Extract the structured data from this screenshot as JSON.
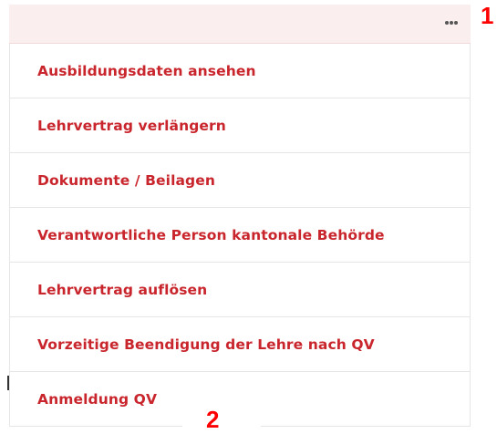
{
  "header": {
    "more_icon": "ellipsis-horizontal-icon",
    "background_color": "#fbeeee"
  },
  "menu": {
    "item_color": "#c9252c",
    "items": [
      {
        "label": "Ausbildungsdaten ansehen"
      },
      {
        "label": "Lehrvertrag verlängern"
      },
      {
        "label": "Dokumente / Beilagen"
      },
      {
        "label": "Verantwortliche Person kantonale Behörde"
      },
      {
        "label": "Lehrvertrag auflösen"
      },
      {
        "label": "Vorzeitige Beendigung der Lehre nach QV"
      },
      {
        "label": "Anmeldung QV"
      }
    ]
  },
  "callouts": {
    "first": "1",
    "second": "2",
    "color": "#ff0000"
  }
}
